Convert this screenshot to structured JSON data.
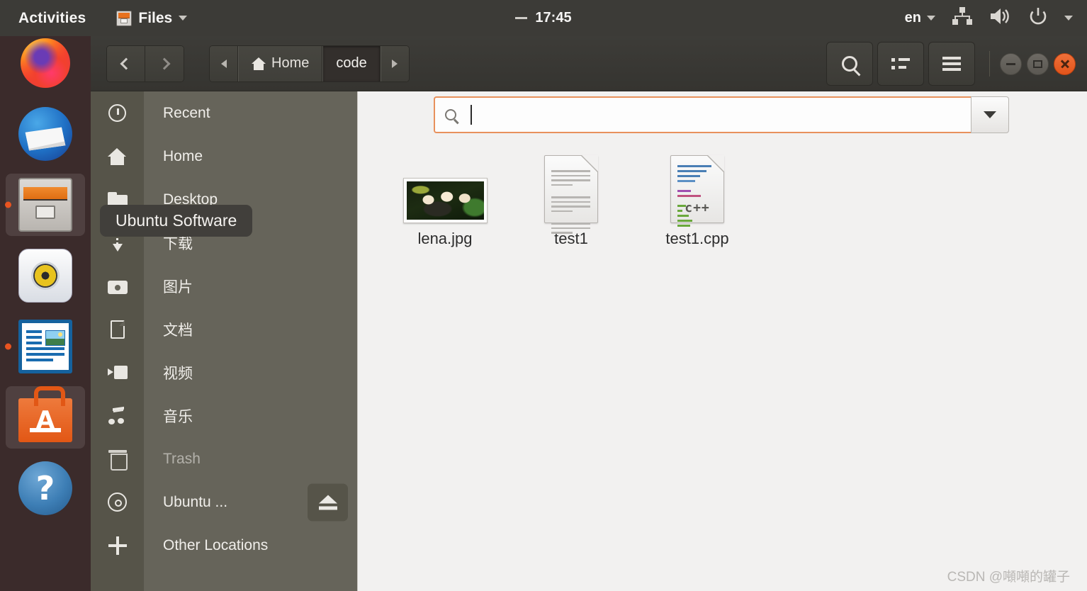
{
  "topbar": {
    "activities": "Activities",
    "app_name": "Files",
    "app_icon": "files-cabinet-icon",
    "clock": "17:45",
    "clock_prefix_icon": "dash-icon",
    "language": "en",
    "tray_icons": [
      "network-wired-icon",
      "volume-icon",
      "power-icon",
      "chevron-down-icon"
    ]
  },
  "dock": {
    "items": [
      {
        "name": "firefox",
        "label": "Firefox",
        "running": false,
        "active": false
      },
      {
        "name": "thunderbird",
        "label": "Thunderbird",
        "running": false,
        "active": false
      },
      {
        "name": "files",
        "label": "Files",
        "running": true,
        "active": true
      },
      {
        "name": "rhythmbox",
        "label": "Rhythmbox",
        "running": false,
        "active": false
      },
      {
        "name": "libreoffice-writer",
        "label": "LibreOffice Writer",
        "running": true,
        "active": false
      },
      {
        "name": "ubuntu-software",
        "label": "Ubuntu Software",
        "running": false,
        "active": true
      },
      {
        "name": "help",
        "label": "Help",
        "running": false,
        "active": false
      }
    ]
  },
  "window": {
    "nav": {
      "back_icon": "chevron-left-icon",
      "forward_icon": "chevron-right-icon"
    },
    "breadcrumb": {
      "scroll_left_icon": "triangle-left-icon",
      "scroll_right_icon": "triangle-right-icon",
      "items": [
        {
          "label": "Home",
          "icon": "home-icon",
          "current": false
        },
        {
          "label": "code",
          "icon": "",
          "current": true
        }
      ]
    },
    "toolbar": {
      "search_icon": "search-icon",
      "view_list_icon": "list-view-icon",
      "menu_icon": "hamburger-menu-icon"
    },
    "window_controls": {
      "minimize_icon": "minimize-icon",
      "maximize_icon": "maximize-icon",
      "close_icon": "close-icon"
    }
  },
  "sidebar": {
    "items": [
      {
        "label": "Recent",
        "icon": "clock-icon"
      },
      {
        "label": "Home",
        "icon": "home-icon"
      },
      {
        "label": "Desktop",
        "icon": "folder-icon"
      },
      {
        "label": "下载",
        "icon": "download-icon"
      },
      {
        "label": "图片",
        "icon": "camera-icon"
      },
      {
        "label": "文档",
        "icon": "document-icon"
      },
      {
        "label": "视频",
        "icon": "video-icon"
      },
      {
        "label": "音乐",
        "icon": "music-icon"
      },
      {
        "label": "Trash",
        "icon": "trash-icon"
      },
      {
        "label": "Ubuntu ...",
        "icon": "disc-icon",
        "eject_icon": "eject-icon"
      },
      {
        "label": "Other Locations",
        "icon": "plus-icon"
      }
    ],
    "tooltip": "Ubuntu Software"
  },
  "search": {
    "value": "",
    "placeholder": "",
    "icon": "search-icon",
    "dropdown_icon": "chevron-down-icon"
  },
  "files": [
    {
      "name": "lena.jpg",
      "type": "image",
      "icon": "image-thumbnail"
    },
    {
      "name": "test1",
      "type": "text",
      "icon": "text-document-icon"
    },
    {
      "name": "test1.cpp",
      "type": "cpp",
      "icon": "cpp-source-icon",
      "badge": "c++"
    }
  ],
  "watermark": "CSDN @噸噸的罐子",
  "colors": {
    "accent": "#e95420",
    "topbar": "#3c3b37",
    "dock": "#3b2b2b",
    "sidebar": "#66645a",
    "content": "#f2f1f0",
    "search_focus": "#e8915c"
  }
}
